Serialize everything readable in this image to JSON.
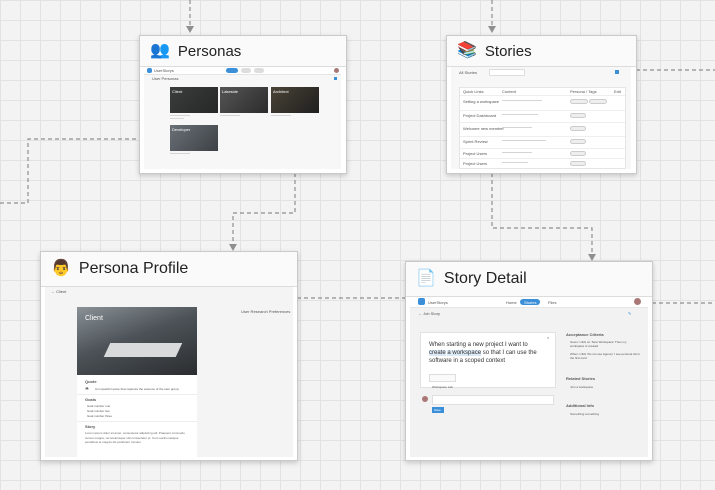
{
  "cards": {
    "personas": {
      "title": "Personas",
      "emoji": "👥"
    },
    "stories": {
      "title": "Stories",
      "emoji": "📚"
    },
    "persona_profile": {
      "title": "Persona Profile",
      "emoji": "👨"
    },
    "story_detail": {
      "title": "Story Detail",
      "emoji": "📄"
    }
  },
  "personas_thumb": {
    "app_name": "UserStorys",
    "filter_label": "User Personas",
    "tiles": [
      "Client",
      "Lakeside",
      "Architect",
      "Developer"
    ]
  },
  "stories_thumb": {
    "filter_label": "All Stories",
    "columns": [
      "Quick Links",
      "Content",
      "Persona / Tags",
      "Edit"
    ],
    "rows": [
      "Setting a workspace",
      "Project Dashboard",
      "Welcome new member",
      "Sprint Review",
      "Project Users",
      "Project Users"
    ]
  },
  "profile_thumb": {
    "back_label": "Client",
    "photo_label": "Client",
    "side_link": "User Research Preferences",
    "quote_heading": "Quote",
    "quote_text": "An impactful quote that captures the essence of the user group.",
    "goals_heading": "Goals",
    "goals": [
      "Goal number one",
      "Goal number two",
      "Goal number three"
    ],
    "story_heading": "Story",
    "story_text": "Lorem ipsum dolor sit amet, consectetur adipiscing elit. Praesent commodo cursus magna, vel scelerisque nisl consectetur et. Cum sociis natoque penatibus et magnis dis parturient montes."
  },
  "detail_thumb": {
    "app_name": "UserStorys",
    "nav": [
      "Home",
      "Stories",
      "Files"
    ],
    "back_label": "Job Story",
    "story_prefix": "When starting a new project I want to",
    "story_highlight1": "create",
    "story_highlight2": "a workspace",
    "story_suffix": "so that I can use the software in a scoped context",
    "tag": "Workspace Lab",
    "save_button": "Save",
    "acceptance_heading": "Acceptance Criteria",
    "acceptance": [
      "Given I click on 'New Workspace' Then my workspace is created",
      "When I click 'Do not use Agency' I see persona list in the first card"
    ],
    "related_heading": "Related Stories",
    "related": [
      "Join a workspace"
    ],
    "additional_heading": "Additional Info",
    "additional": [
      "Something something"
    ]
  }
}
